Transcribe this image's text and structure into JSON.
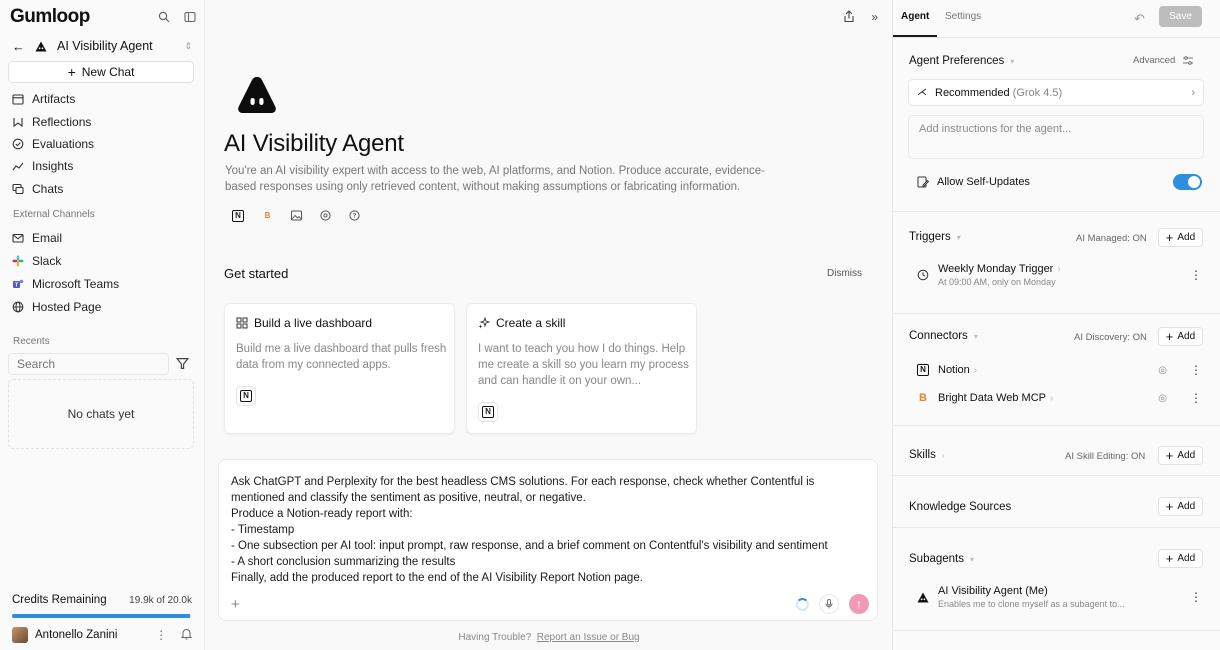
{
  "sidebar": {
    "logo": "Gumloop",
    "agent_name": "AI Visibility Agent",
    "new_chat": "New Chat",
    "nav": [
      {
        "label": "Artifacts",
        "icon": "calendar-icon"
      },
      {
        "label": "Reflections",
        "icon": "reflections-icon"
      },
      {
        "label": "Evaluations",
        "icon": "check-circle-icon"
      },
      {
        "label": "Insights",
        "icon": "chart-icon"
      },
      {
        "label": "Chats",
        "icon": "chat-icon"
      }
    ],
    "external_label": "External Channels",
    "external": [
      {
        "label": "Email",
        "icon": "mail-icon"
      },
      {
        "label": "Slack",
        "icon": "slack-icon"
      },
      {
        "label": "Microsoft Teams",
        "icon": "teams-icon"
      },
      {
        "label": "Hosted Page",
        "icon": "globe-icon"
      }
    ],
    "recents_label": "Recents",
    "search_placeholder": "Search",
    "empty": "No chats yet",
    "credits_label": "Credits Remaining",
    "credits_value": "19.9k of 20.0k",
    "credits_fraction": 0.995,
    "user_name": "Antonello Zanini"
  },
  "main": {
    "title": "AI Visibility Agent",
    "description": "You're an AI visibility expert with access to the web, AI platforms, and Notion. Produce accurate, evidence-based responses using only retrieved content, without making assumptions or fabricating information.",
    "tools": [
      "notion-icon",
      "bright-data-icon",
      "image-icon",
      "chatgpt-icon",
      "perplexity-icon"
    ],
    "get_started": "Get started",
    "dismiss": "Dismiss",
    "cards": [
      {
        "title": "Build a live dashboard",
        "body": "Build me a live dashboard that pulls fresh data from my connected apps."
      },
      {
        "title": "Create a skill",
        "body": "I want to teach you how I do things. Help me create a skill so you learn my process and can handle it on your own..."
      }
    ],
    "prompt": "Ask ChatGPT and Perplexity for the best headless CMS solutions. For each response, check whether Contentful is mentioned and classify the sentiment as positive, neutral, or negative.\nProduce a Notion-ready report with:\n- Timestamp\n- One subsection per AI tool: input prompt, raw response, and a brief comment on Contentful's visibility and sentiment\n- A short conclusion summarizing the results\nFinally, add the produced report to the end of the AI Visibility Report Notion page.",
    "trouble_text": "Having Trouble?",
    "trouble_link": "Report an Issue or Bug"
  },
  "right": {
    "tab_agent": "Agent",
    "tab_settings": "Settings",
    "save": "Save",
    "preferences_title": "Agent Preferences",
    "advanced": "Advanced",
    "model_label": "Recommended",
    "model_detail": "(Grok 4.5)",
    "instructions_placeholder": "Add instructions for the agent...",
    "self_updates": "Allow Self-Updates",
    "triggers_title": "Triggers",
    "triggers_meta": "AI Managed: ON",
    "add": "Add",
    "trigger_name": "Weekly Monday Trigger",
    "trigger_sub": "At 09:00 AM, only on Monday",
    "connectors_title": "Connectors",
    "connectors_meta": "AI Discovery: ON",
    "connector1": "Notion",
    "connector2": "Bright Data Web MCP",
    "skills_title": "Skills",
    "skills_meta": "AI Skill Editing: ON",
    "knowledge_title": "Knowledge Sources",
    "subagents_title": "Subagents",
    "subagent_name": "AI Visibility Agent (Me)",
    "subagent_sub": "Enables me to clone myself as a subagent to..."
  }
}
